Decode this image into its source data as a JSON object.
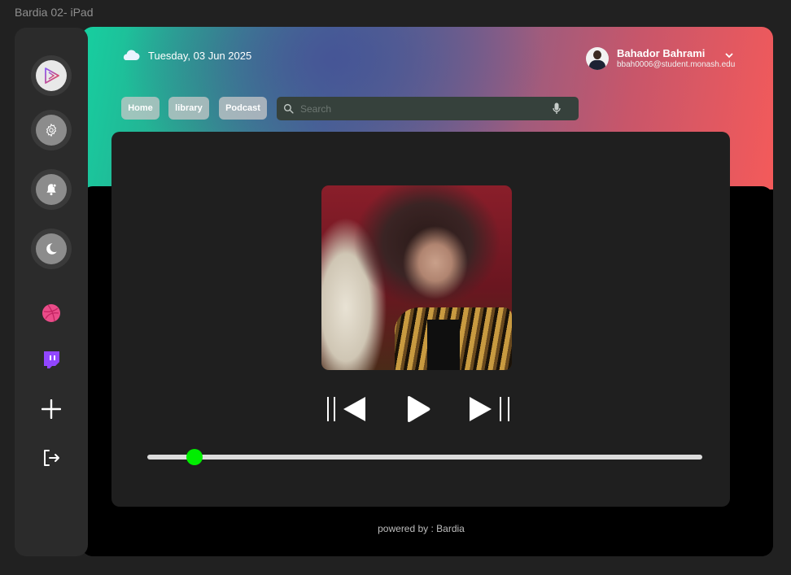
{
  "frame": {
    "title": "Bardia 02- iPad"
  },
  "sidebar": {
    "items": [
      {
        "name": "app-logo",
        "icon": "play-logo-icon"
      },
      {
        "name": "settings",
        "icon": "gear-icon"
      },
      {
        "name": "notifications",
        "icon": "bell-icon"
      },
      {
        "name": "dark-mode",
        "icon": "moon-icon"
      },
      {
        "name": "dribbble",
        "icon": "dribbble-icon",
        "color": "#ea4c89"
      },
      {
        "name": "twitch",
        "icon": "twitch-icon",
        "color": "#9146ff"
      },
      {
        "name": "add",
        "icon": "plus-icon"
      },
      {
        "name": "logout",
        "icon": "logout-icon"
      }
    ]
  },
  "header": {
    "weather_icon": "cloud-icon",
    "date": "Tuesday, 03 Jun 2025",
    "user": {
      "name": "Bahador Bahrami",
      "email": "bbah0006@student.monash.edu"
    }
  },
  "nav": {
    "tabs": [
      {
        "label": "Home"
      },
      {
        "label": "library"
      },
      {
        "label": "Podcast"
      }
    ]
  },
  "search": {
    "placeholder": "Search",
    "value": ""
  },
  "player": {
    "progress": 0.085,
    "progress_color": "#00ee00"
  },
  "footer": {
    "text": "powered by : Bardia"
  },
  "colors": {
    "background": "#212121",
    "sidebar": "#2b2b2b",
    "card": "#1f1f1f",
    "gradient_start": "#16d0a0",
    "gradient_end": "#f45a5a"
  }
}
